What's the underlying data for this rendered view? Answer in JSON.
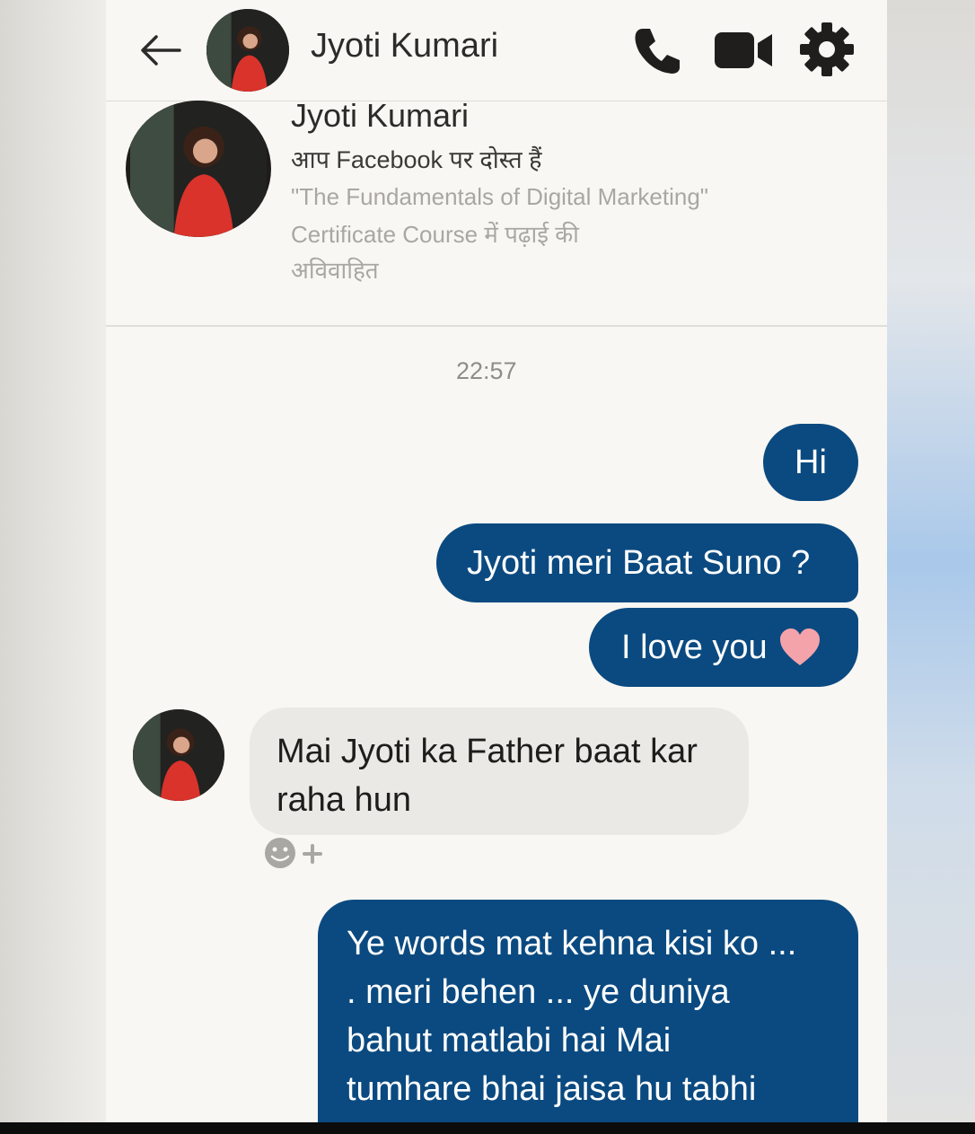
{
  "header": {
    "contact_name": "Jyoti Kumari",
    "icons": [
      "back-arrow-icon",
      "call-icon",
      "video-icon",
      "settings-icon"
    ]
  },
  "profile": {
    "name": "Jyoti Kumari",
    "friend_status": "आप Facebook पर दोस्त हैं",
    "course_line1": "\"The Fundamentals of Digital Marketing\"",
    "course_line2": "Certificate Course में पढ़ाई की",
    "relationship": "अविवाहित"
  },
  "chat": {
    "timestamp": "22:57",
    "messages": [
      {
        "from": "me",
        "text": "Hi"
      },
      {
        "from": "me",
        "text": "Jyoti meri Baat Suno ?"
      },
      {
        "from": "me",
        "text": "I love you",
        "emoji": "heart-icon"
      },
      {
        "from": "them",
        "line1": "Mai Jyoti ka Father baat kar",
        "line2": "raha hun"
      },
      {
        "from": "me",
        "line1": "Ye words mat kehna kisi ko ...",
        "line2": ". meri behen ... ye duniya",
        "line3": "bahut matlabi hai Mai",
        "line4": "tumhare bhai jaisa hu tabhi"
      }
    ]
  },
  "colors": {
    "sent_bubble": "#0b4a80",
    "received_bubble": "#ebe9e5",
    "background": "#f8f7f3"
  }
}
